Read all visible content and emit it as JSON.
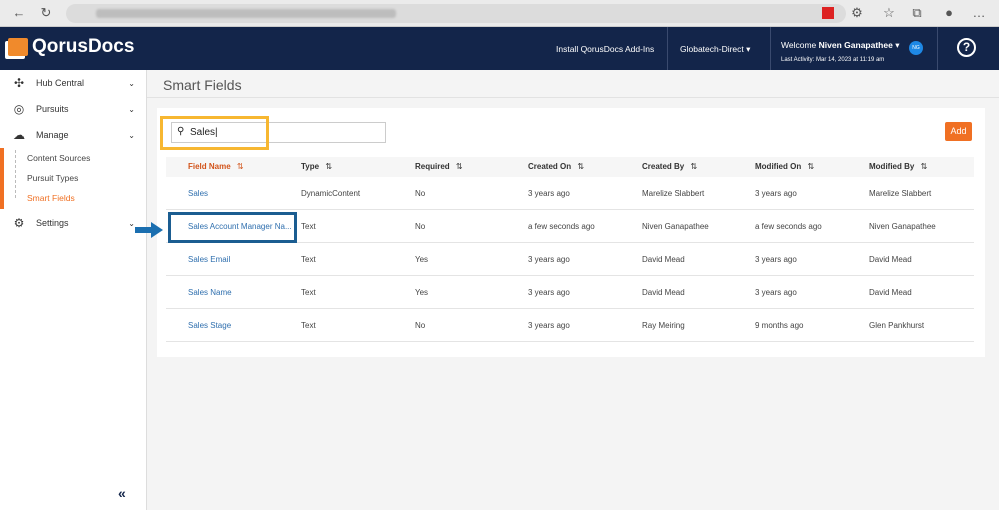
{
  "app": {
    "name": "QorusDocs"
  },
  "header": {
    "install": "Install QorusDocs Add-Ins",
    "tenant": "Globatech-Direct",
    "welcome": "Welcome",
    "user": "Niven Ganapathee",
    "initials": "NG",
    "last_activity": "Last Activity: Mar 14, 2023 at 11:19 am",
    "help": "?"
  },
  "sidebar": {
    "items": [
      {
        "label": "Hub Central"
      },
      {
        "label": "Pursuits"
      },
      {
        "label": "Manage"
      },
      {
        "label": "Settings"
      }
    ],
    "sub": [
      {
        "label": "Content Sources"
      },
      {
        "label": "Pursuit Types"
      },
      {
        "label": "Smart Fields"
      }
    ],
    "collapse": "«"
  },
  "page": {
    "title": "Smart Fields",
    "search_value": "Sales",
    "add": "Add"
  },
  "table": {
    "headers": [
      "Field Name",
      "Type",
      "Required",
      "Created On",
      "Created By",
      "Modified On",
      "Modified By"
    ],
    "rows": [
      [
        "Sales",
        "DynamicContent",
        "No",
        "3 years ago",
        "Marelize Slabbert",
        "3 years ago",
        "Marelize Slabbert"
      ],
      [
        "Sales Account Manager Na...",
        "Text",
        "No",
        "a few seconds ago",
        "Niven Ganapathee",
        "a few seconds ago",
        "Niven Ganapathee"
      ],
      [
        "Sales Email",
        "Text",
        "Yes",
        "3 years ago",
        "David Mead",
        "3 years ago",
        "David Mead"
      ],
      [
        "Sales Name",
        "Text",
        "Yes",
        "3 years ago",
        "David Mead",
        "3 years ago",
        "David Mead"
      ],
      [
        "Sales Stage",
        "Text",
        "No",
        "3 years ago",
        "Ray Meiring",
        "9 months ago",
        "Glen Pankhurst"
      ]
    ]
  },
  "colors": {
    "header": "#13254a",
    "accent": "#f07023",
    "highlight_search": "#f7b731",
    "highlight_row": "#1b5d91"
  }
}
